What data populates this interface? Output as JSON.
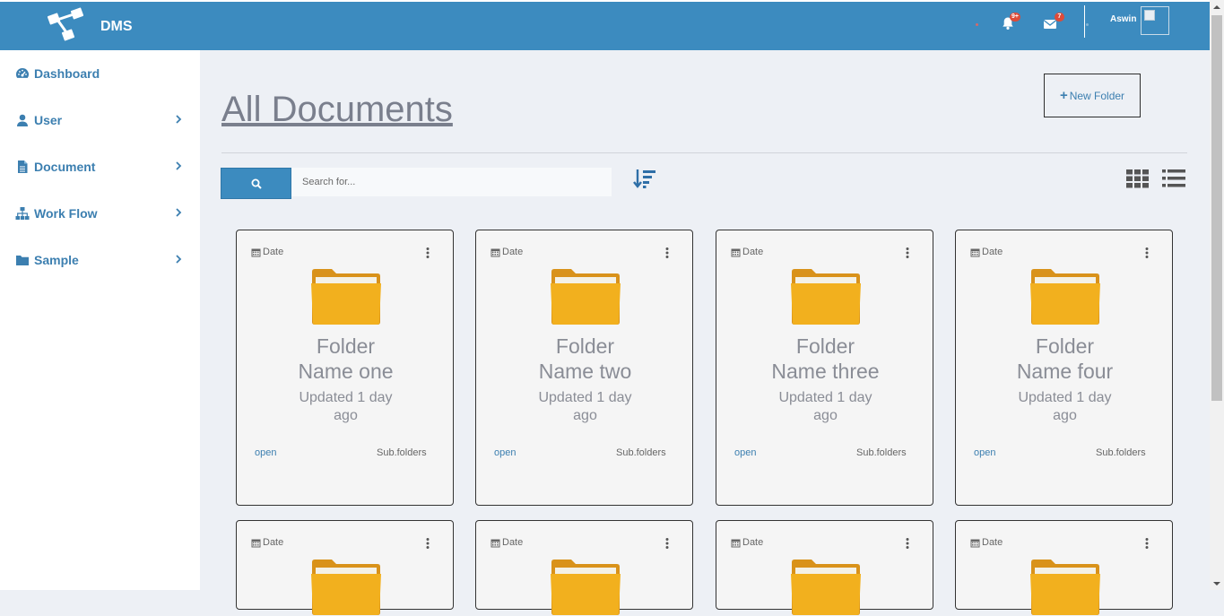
{
  "header": {
    "brand": "DMS",
    "notifications_badge": "9+",
    "messages_badge": "7",
    "user_name": "Aswin"
  },
  "sidebar": {
    "items": [
      {
        "label": "Dashboard",
        "icon": "tachometer-icon",
        "has_submenu": false
      },
      {
        "label": "User",
        "icon": "user-icon",
        "has_submenu": true
      },
      {
        "label": "Document",
        "icon": "document-icon",
        "has_submenu": true
      },
      {
        "label": "Work Flow",
        "icon": "sitemap-icon",
        "has_submenu": true
      },
      {
        "label": "Sample",
        "icon": "folder-icon",
        "has_submenu": true
      }
    ]
  },
  "main": {
    "title": "All Documents",
    "new_folder_label": "New Folder",
    "search": {
      "placeholder": "Search for..."
    }
  },
  "cards": [
    {
      "date_label": "Date",
      "name_line1": "Folder",
      "name_line2": "Name one",
      "updated_line1": "Updated 1 day",
      "updated_line2": "ago",
      "open_label": "open",
      "subfolders_label": "Sub.folders"
    },
    {
      "date_label": "Date",
      "name_line1": "Folder",
      "name_line2": "Name two",
      "updated_line1": "Updated 1 day",
      "updated_line2": "ago",
      "open_label": "open",
      "subfolders_label": "Sub.folders"
    },
    {
      "date_label": "Date",
      "name_line1": "Folder",
      "name_line2": "Name three",
      "updated_line1": "Updated 1 day",
      "updated_line2": "ago",
      "open_label": "open",
      "subfolders_label": "Sub.folders"
    },
    {
      "date_label": "Date",
      "name_line1": "Folder",
      "name_line2": "Name four",
      "updated_line1": "Updated 1 day",
      "updated_line2": "ago",
      "open_label": "open",
      "subfolders_label": "Sub.folders"
    },
    {
      "date_label": "Date"
    },
    {
      "date_label": "Date"
    },
    {
      "date_label": "Date"
    },
    {
      "date_label": "Date"
    }
  ],
  "colors": {
    "header_bg": "#3c8bbf",
    "sidebar_text": "#3c7fb0",
    "page_bg": "#edf0f5",
    "badge": "#dd4b39",
    "folder_yellow": "#f2b01e"
  }
}
